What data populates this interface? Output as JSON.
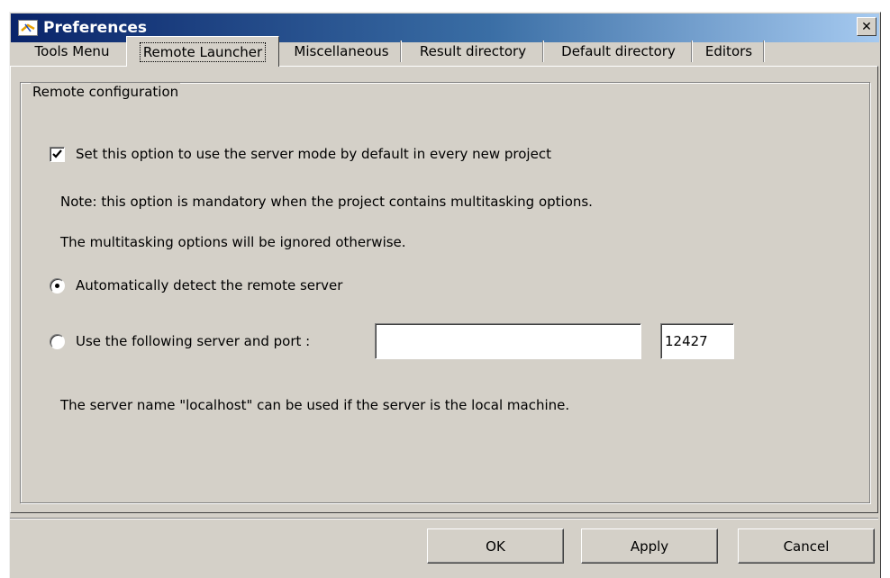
{
  "window": {
    "title": "Preferences",
    "close_symbol": "✕",
    "icon": "app-icon"
  },
  "tabs": [
    {
      "label": "Tools Menu",
      "active": false
    },
    {
      "label": "Remote Launcher",
      "active": true
    },
    {
      "label": "Miscellaneous",
      "active": false
    },
    {
      "label": "Result directory",
      "active": false
    },
    {
      "label": "Default directory",
      "active": false
    },
    {
      "label": "Editors",
      "active": false
    }
  ],
  "remote": {
    "group_label": "Remote configuration",
    "server_mode_checkbox": {
      "label": "Set this option to use the server mode by default in every new project",
      "checked": true
    },
    "note_line1": "Note: this option is mandatory when the project contains multitasking options.",
    "note_line2": "The multitasking options will be ignored otherwise.",
    "radio_auto": {
      "label": "Automatically detect the remote server",
      "selected": true
    },
    "radio_manual": {
      "label": "Use the following server and port :",
      "selected": false
    },
    "server_value": "",
    "port_value": "12427",
    "hint": "The server name \"localhost\" can be used if the server is the local machine."
  },
  "buttons": {
    "ok": "OK",
    "apply": "Apply",
    "cancel": "Cancel"
  },
  "colors": {
    "titlebar_start": "#0a246a",
    "titlebar_end": "#a6caf0",
    "face": "#d4d0c8"
  }
}
